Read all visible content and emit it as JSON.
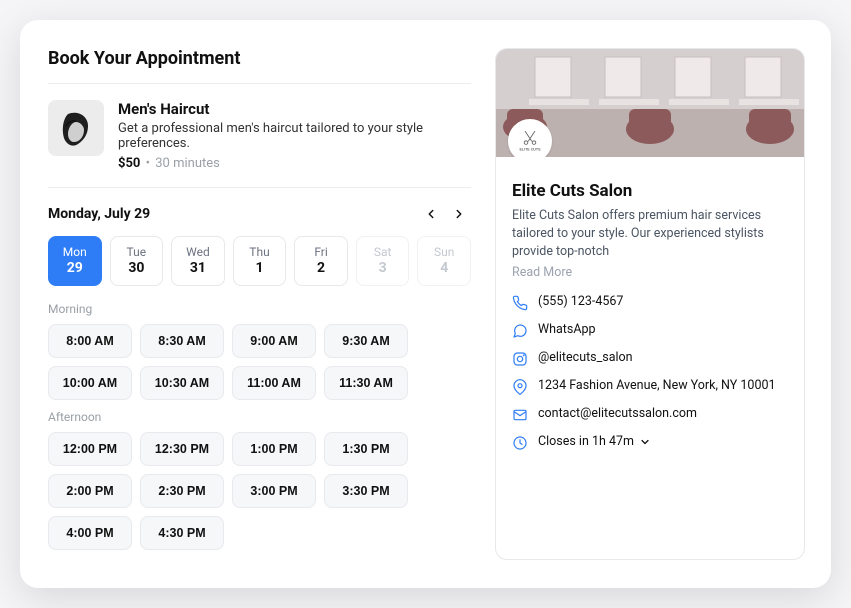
{
  "title": "Book Your Appointment",
  "service": {
    "name": "Men's Haircut",
    "description": "Get a professional men's haircut tailored to your style preferences.",
    "price": "$50",
    "duration": "30 minutes"
  },
  "calendar": {
    "selected_full_date": "Monday, July 29",
    "days": [
      {
        "dow": "Mon",
        "num": "29",
        "selected": true,
        "disabled": false
      },
      {
        "dow": "Tue",
        "num": "30",
        "selected": false,
        "disabled": false
      },
      {
        "dow": "Wed",
        "num": "31",
        "selected": false,
        "disabled": false
      },
      {
        "dow": "Thu",
        "num": "1",
        "selected": false,
        "disabled": false
      },
      {
        "dow": "Fri",
        "num": "2",
        "selected": false,
        "disabled": false
      },
      {
        "dow": "Sat",
        "num": "3",
        "selected": false,
        "disabled": true
      },
      {
        "dow": "Sun",
        "num": "4",
        "selected": false,
        "disabled": true
      }
    ]
  },
  "slots": {
    "morning_label": "Morning",
    "afternoon_label": "Afternoon",
    "morning": [
      "8:00 AM",
      "8:30 AM",
      "9:00 AM",
      "9:30 AM",
      "10:00 AM",
      "10:30 AM",
      "11:00 AM",
      "11:30 AM"
    ],
    "afternoon": [
      "12:00 PM",
      "12:30 PM",
      "1:00 PM",
      "1:30 PM",
      "2:00 PM",
      "2:30 PM",
      "3:00 PM",
      "3:30 PM",
      "4:00 PM",
      "4:30 PM"
    ]
  },
  "salon": {
    "logo_text": "ELITE CUTS",
    "name": "Elite Cuts Salon",
    "description": "Elite Cuts Salon offers premium hair services tailored to your style. Our experienced stylists provide top-notch",
    "read_more": "Read More",
    "contacts": {
      "phone": "(555) 123-4567",
      "whatsapp": "WhatsApp",
      "instagram": "@elitecuts_salon",
      "address": "1234 Fashion Avenue, New York, NY 10001",
      "email": "contact@elitecutssalon.com",
      "hours": "Closes in 1h 47m"
    }
  }
}
